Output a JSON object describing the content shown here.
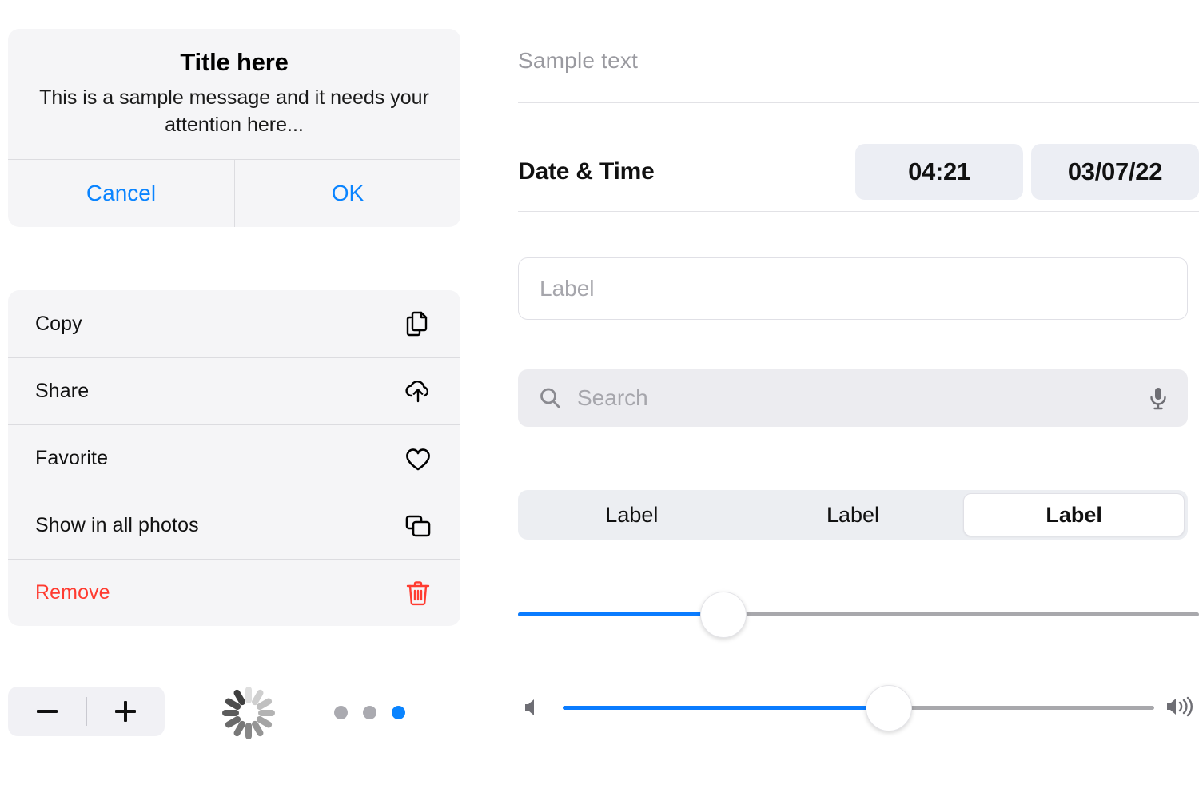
{
  "alert": {
    "title": "Title here",
    "message": "This is a sample message and it needs your attention here...",
    "cancel_label": "Cancel",
    "ok_label": "OK",
    "accent_color": "#0a84ff"
  },
  "action_list": {
    "items": [
      {
        "label": "Copy",
        "icon": "copy-documents-icon",
        "danger": false
      },
      {
        "label": "Share",
        "icon": "cloud-upload-icon",
        "danger": false
      },
      {
        "label": "Favorite",
        "icon": "heart-icon",
        "danger": false
      },
      {
        "label": "Show in all photos",
        "icon": "duplicate-squares-icon",
        "danger": false
      },
      {
        "label": "Remove",
        "icon": "trash-icon",
        "danger": true
      }
    ],
    "danger_color": "#ff3b30"
  },
  "stepper": {
    "decrement_label": "−",
    "increment_label": "+"
  },
  "spinner": {
    "spokes": 12
  },
  "page_dots": {
    "count": 3,
    "active_index": 2,
    "active_color": "#0a84ff",
    "inactive_color": "#aaaab0"
  },
  "right_panel": {
    "section_header": "Sample text",
    "datetime": {
      "label": "Date & Time",
      "time_value": "04:21",
      "date_value": "03/07/22"
    },
    "text_field": {
      "value": "",
      "placeholder": "Label"
    },
    "search": {
      "value": "",
      "placeholder": "Search",
      "search_icon": "search-icon",
      "mic_icon": "microphone-icon"
    },
    "segmented": {
      "options": [
        "Label",
        "Label",
        "Label"
      ],
      "selected_index": 2
    },
    "slider": {
      "value_percent": 30,
      "fill_color": "#0a7cff",
      "track_color": "#a8a8ac"
    },
    "volume_slider": {
      "value_percent": 55,
      "fill_color": "#0a7cff",
      "track_color": "#a8a8ac",
      "min_icon": "speaker-mute-icon",
      "max_icon": "speaker-high-icon"
    }
  }
}
